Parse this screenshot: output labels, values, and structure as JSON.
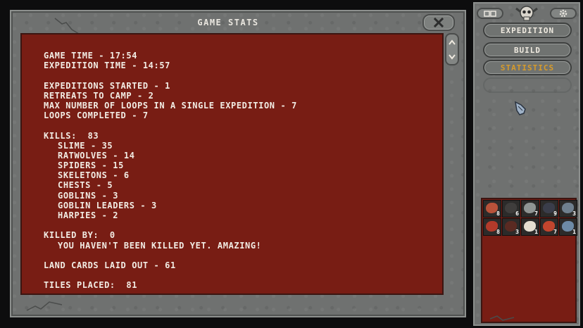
{
  "window": {
    "title": "GAME STATS",
    "close_icon": "close-icon"
  },
  "stats": {
    "game_time": "GAME TIME - 17:54",
    "expedition_time": "EXPEDITION TIME - 14:57",
    "expeditions_started": "EXPEDITIONS STARTED - 1",
    "retreats": "RETREATS TO CAMP - 2",
    "max_loops": "MAX NUMBER OF LOOPS IN A SINGLE EXPEDITION - 7",
    "loops_completed": "LOOPS COMPLETED - 7",
    "kills_header": "KILLS:  83",
    "kills": [
      "SLIME - 35",
      "RATWOLVES - 14",
      "SPIDERS - 15",
      "SKELETONS - 6",
      "CHESTS - 5",
      "GOBLINS - 3",
      "GOBLIN LEADERS - 3",
      "HARPIES - 2"
    ],
    "killed_by_header": "KILLED BY:  0",
    "killed_by_note": "YOU HAVEN'T BEEN KILLED YET. AMAZING!",
    "land_cards": "LAND CARDS LAID OUT - 61",
    "tiles_placed": "TILES PLACED:  81"
  },
  "sidebar": {
    "nav": [
      {
        "label": "EXPEDITION",
        "active": false
      },
      {
        "label": "BUILD",
        "active": false
      },
      {
        "label": "STATISTICS",
        "active": true
      }
    ],
    "inventory": [
      {
        "count": "8",
        "color": "#b8523a"
      },
      {
        "count": "6",
        "color": "#3f3d3c"
      },
      {
        "count": "7",
        "color": "#8f9493"
      },
      {
        "count": "9",
        "color": "#3a3d4a"
      },
      {
        "count": "3",
        "color": "#6f7f8e"
      },
      {
        "count": "8",
        "color": "#b33a2a"
      },
      {
        "count": "3",
        "color": "#5a2a22"
      },
      {
        "count": "1",
        "color": "#e6ded0"
      },
      {
        "count": "7",
        "color": "#c2452e"
      },
      {
        "count": "1",
        "color": "#6d8aa6"
      }
    ]
  },
  "colors": {
    "panel_red": "#781d14",
    "stone": "#6f7170",
    "accent_gold": "#d79b2a",
    "text": "#f2ece4"
  }
}
